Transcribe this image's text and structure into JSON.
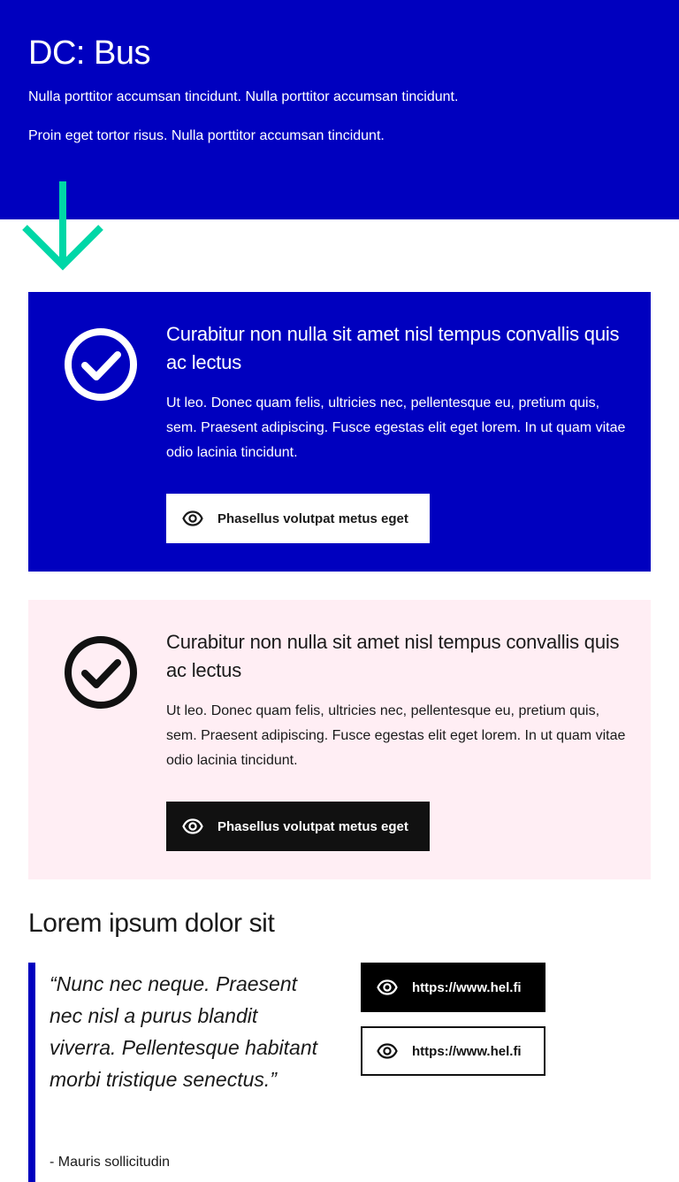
{
  "colors": {
    "brand_blue": "#0000bf",
    "accent_green": "#00d7a7",
    "pink_background": "#ffeef4",
    "dark": "#111111"
  },
  "hero": {
    "title": "DC: Bus",
    "paragraphs": [
      "Nulla porttitor accumsan tincidunt. Nulla porttitor accumsan tincidunt.",
      "Proin eget tortor risus. Nulla porttitor accumsan tincidunt."
    ],
    "arrow_icon": "arrow-down-icon"
  },
  "cards": [
    {
      "variant": "blue",
      "icon": "check-circle-icon",
      "title": "Curabitur non nulla sit amet nisl tempus convallis quis ac lectus",
      "body": "Ut leo. Donec quam felis, ultricies nec, pellentesque eu, pretium quis, sem. Praesent adipiscing. Fusce egestas elit eget lorem. In ut quam vitae odio lacinia tincidunt.",
      "button_label": "Phasellus volutpat metus eget",
      "button_icon": "eye-icon"
    },
    {
      "variant": "pink",
      "icon": "check-circle-icon",
      "title": "Curabitur non nulla sit amet nisl tempus convallis quis ac lectus",
      "body": "Ut leo. Donec quam felis, ultricies nec, pellentesque eu, pretium quis, sem. Praesent adipiscing. Fusce egestas elit eget lorem. In ut quam vitae odio lacinia tincidunt.",
      "button_label": "Phasellus volutpat metus eget",
      "button_icon": "eye-icon"
    }
  ],
  "section": {
    "title": "Lorem ipsum dolor sit",
    "quote": "“Nunc nec neque. Praesent nec nisl a purus blandit viverra. Pellentesque habitant morbi tristique senectus.”",
    "author": "- Mauris sollicitudin",
    "links": [
      {
        "label": "https://www.hel.fi",
        "style": "filled",
        "icon": "eye-icon"
      },
      {
        "label": "https://www.hel.fi",
        "style": "outline",
        "icon": "eye-icon"
      }
    ]
  }
}
